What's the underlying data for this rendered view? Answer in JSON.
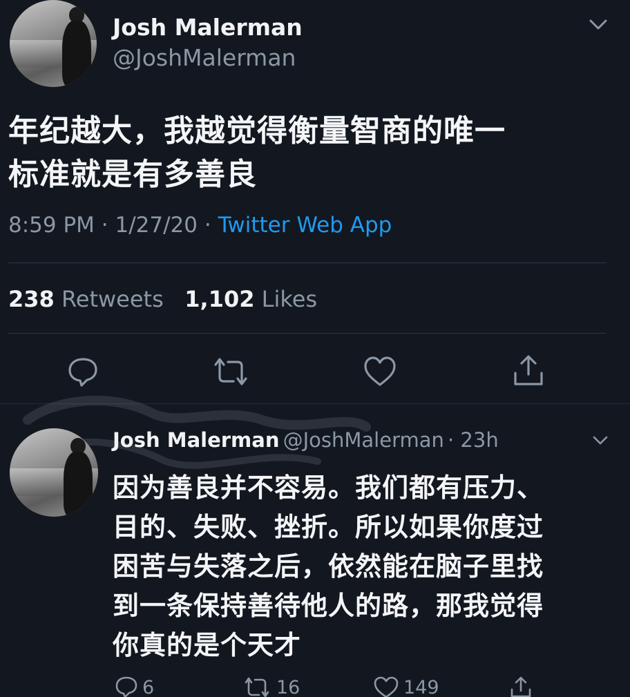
{
  "main_tweet": {
    "author_name": "Josh Malerman",
    "author_handle": "@JoshMalerman",
    "text": "年纪越大，我越觉得衡量智商的唯一\n标准就是有多善良",
    "time": "8:59 PM",
    "date": "1/27/20",
    "separator": "·",
    "source": "Twitter Web App",
    "retweets_count": "238",
    "retweets_label": "Retweets",
    "likes_count": "1,102",
    "likes_label": "Likes"
  },
  "reply_tweet": {
    "author_name": "Josh Malerman",
    "author_handle": "@JoshMalerman",
    "age": "· 23h",
    "text": "因为善良并不容易。我们都有压力、\n目的、失败、挫折。所以如果你度过\n困苦与失落之后，依然能在脑子里找\n到一条保持善待他人的路，那我觉得\n你真的是个天才",
    "reply_count": "6",
    "retweet_count": "16",
    "like_count": "149"
  },
  "icons": {
    "caret": "chevron-down-icon",
    "reply": "reply-icon",
    "retweet": "retweet-icon",
    "like": "heart-icon",
    "share": "share-icon"
  },
  "colors": {
    "background": "#131720",
    "link": "#1d9bf0",
    "secondary_text": "#8b98a5"
  }
}
